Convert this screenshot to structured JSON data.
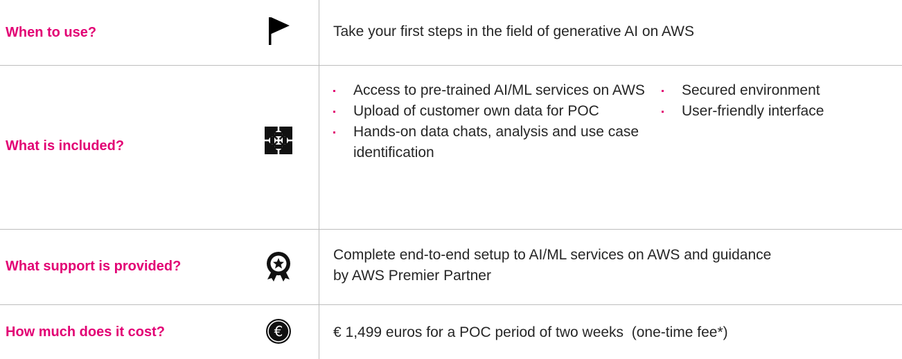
{
  "rows": [
    {
      "label": "When to use?",
      "icon": "flag-icon",
      "text": "Take your first steps in the field of generative AI on AWS"
    },
    {
      "label": "What is included?",
      "icon": "puzzle-icon",
      "bullets_left": [
        "Access to pre-trained AI/ML services on AWS",
        "Upload of customer own data for POC",
        "Hands-on data chats, analysis and use case identification"
      ],
      "bullets_right": [
        "Secured environment",
        "User-friendly interface"
      ]
    },
    {
      "label": "What support is provided?",
      "icon": "award-badge-icon",
      "text": "Complete end-to-end setup to AI/ML services on AWS and guidance by AWS Premier Partner"
    },
    {
      "label": "How much does it cost?",
      "icon": "euro-coin-icon",
      "text": "€ 1,499 euros for a POC period of two weeks  (one-time fee*)"
    }
  ],
  "colors": {
    "accent": "#e20074",
    "text": "#262626",
    "rule": "#bdbdbd"
  }
}
